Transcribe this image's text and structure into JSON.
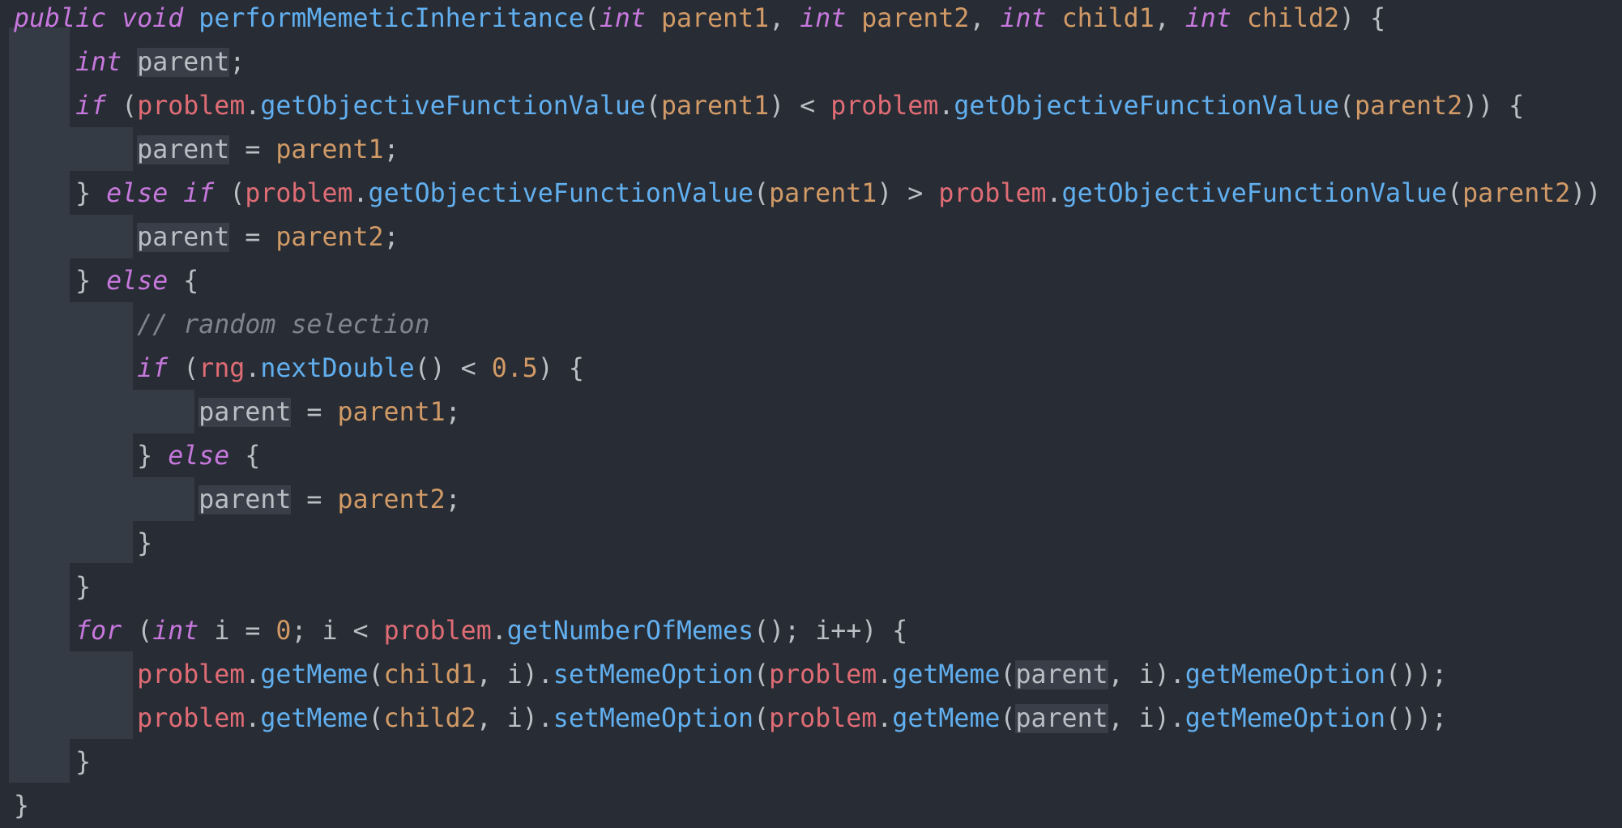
{
  "editor": {
    "language": "java",
    "colors": {
      "background": "#282c34",
      "keyword": "#c678dd",
      "method": "#61afef",
      "parameter": "#d19a66",
      "field": "#e06c75",
      "comment": "#7f848e",
      "text": "#bbbec4"
    },
    "lines": [
      {
        "tokens": [
          {
            "t": "public",
            "c": "kw"
          },
          {
            "t": " ",
            "c": "pl"
          },
          {
            "t": "void",
            "c": "kw"
          },
          {
            "t": " ",
            "c": "pl"
          },
          {
            "t": "performMemeticInheritance",
            "c": "fn"
          },
          {
            "t": "(",
            "c": "pl"
          },
          {
            "t": "int",
            "c": "kw"
          },
          {
            "t": " ",
            "c": "pl"
          },
          {
            "t": "parent1",
            "c": "param"
          },
          {
            "t": ", ",
            "c": "pl"
          },
          {
            "t": "int",
            "c": "kw"
          },
          {
            "t": " ",
            "c": "pl"
          },
          {
            "t": "parent2",
            "c": "param"
          },
          {
            "t": ", ",
            "c": "pl"
          },
          {
            "t": "int",
            "c": "kw"
          },
          {
            "t": " ",
            "c": "pl"
          },
          {
            "t": "child1",
            "c": "param"
          },
          {
            "t": ", ",
            "c": "pl"
          },
          {
            "t": "int",
            "c": "kw"
          },
          {
            "t": " ",
            "c": "pl"
          },
          {
            "t": "child2",
            "c": "param"
          },
          {
            "t": ") {",
            "c": "pl"
          }
        ]
      },
      {
        "tokens": [
          {
            "t": "    ",
            "c": "pl"
          },
          {
            "t": "int",
            "c": "kw"
          },
          {
            "t": " ",
            "c": "pl"
          },
          {
            "t": "parent",
            "c": "pl hl"
          },
          {
            "t": ";",
            "c": "pl"
          }
        ]
      },
      {
        "tokens": [
          {
            "t": "    ",
            "c": "pl"
          },
          {
            "t": "if",
            "c": "kw"
          },
          {
            "t": " (",
            "c": "pl"
          },
          {
            "t": "problem",
            "c": "obj"
          },
          {
            "t": ".",
            "c": "pl"
          },
          {
            "t": "getObjectiveFunctionValue",
            "c": "fn"
          },
          {
            "t": "(",
            "c": "pl"
          },
          {
            "t": "parent1",
            "c": "param"
          },
          {
            "t": ") < ",
            "c": "pl"
          },
          {
            "t": "problem",
            "c": "obj"
          },
          {
            "t": ".",
            "c": "pl"
          },
          {
            "t": "getObjectiveFunctionValue",
            "c": "fn"
          },
          {
            "t": "(",
            "c": "pl"
          },
          {
            "t": "parent2",
            "c": "param"
          },
          {
            "t": ")) {",
            "c": "pl"
          }
        ]
      },
      {
        "tokens": [
          {
            "t": "        ",
            "c": "pl"
          },
          {
            "t": "parent",
            "c": "pl hl"
          },
          {
            "t": " = ",
            "c": "pl"
          },
          {
            "t": "parent1",
            "c": "param"
          },
          {
            "t": ";",
            "c": "pl"
          }
        ]
      },
      {
        "tokens": [
          {
            "t": "    } ",
            "c": "pl"
          },
          {
            "t": "else",
            "c": "kw"
          },
          {
            "t": " ",
            "c": "pl"
          },
          {
            "t": "if",
            "c": "kw"
          },
          {
            "t": " (",
            "c": "pl"
          },
          {
            "t": "problem",
            "c": "obj"
          },
          {
            "t": ".",
            "c": "pl"
          },
          {
            "t": "getObjectiveFunctionValue",
            "c": "fn"
          },
          {
            "t": "(",
            "c": "pl"
          },
          {
            "t": "parent1",
            "c": "param"
          },
          {
            "t": ") > ",
            "c": "pl"
          },
          {
            "t": "problem",
            "c": "obj"
          },
          {
            "t": ".",
            "c": "pl"
          },
          {
            "t": "getObjectiveFunctionValue",
            "c": "fn"
          },
          {
            "t": "(",
            "c": "pl"
          },
          {
            "t": "parent2",
            "c": "param"
          },
          {
            "t": "))",
            "c": "pl"
          }
        ]
      },
      {
        "tokens": [
          {
            "t": "        ",
            "c": "pl"
          },
          {
            "t": "parent",
            "c": "pl hl"
          },
          {
            "t": " = ",
            "c": "pl"
          },
          {
            "t": "parent2",
            "c": "param"
          },
          {
            "t": ";",
            "c": "pl"
          }
        ]
      },
      {
        "tokens": [
          {
            "t": "    } ",
            "c": "pl"
          },
          {
            "t": "else",
            "c": "kw"
          },
          {
            "t": " {",
            "c": "pl"
          }
        ]
      },
      {
        "tokens": [
          {
            "t": "        ",
            "c": "pl"
          },
          {
            "t": "// random selection",
            "c": "cm"
          }
        ]
      },
      {
        "tokens": [
          {
            "t": "        ",
            "c": "pl"
          },
          {
            "t": "if",
            "c": "kw"
          },
          {
            "t": " (",
            "c": "pl"
          },
          {
            "t": "rng",
            "c": "obj"
          },
          {
            "t": ".",
            "c": "pl"
          },
          {
            "t": "nextDouble",
            "c": "fn"
          },
          {
            "t": "() < ",
            "c": "pl"
          },
          {
            "t": "0.5",
            "c": "num"
          },
          {
            "t": ") {",
            "c": "pl"
          }
        ]
      },
      {
        "tokens": [
          {
            "t": "            ",
            "c": "pl"
          },
          {
            "t": "parent",
            "c": "pl hl"
          },
          {
            "t": " = ",
            "c": "pl"
          },
          {
            "t": "parent1",
            "c": "param"
          },
          {
            "t": ";",
            "c": "pl"
          }
        ]
      },
      {
        "tokens": [
          {
            "t": "        } ",
            "c": "pl"
          },
          {
            "t": "else",
            "c": "kw"
          },
          {
            "t": " {",
            "c": "pl"
          }
        ]
      },
      {
        "tokens": [
          {
            "t": "            ",
            "c": "pl"
          },
          {
            "t": "parent",
            "c": "pl hl"
          },
          {
            "t": " = ",
            "c": "pl"
          },
          {
            "t": "parent2",
            "c": "param"
          },
          {
            "t": ";",
            "c": "pl"
          }
        ]
      },
      {
        "tokens": [
          {
            "t": "        }",
            "c": "pl"
          }
        ]
      },
      {
        "tokens": [
          {
            "t": "    }",
            "c": "pl"
          }
        ]
      },
      {
        "tokens": [
          {
            "t": "    ",
            "c": "pl"
          },
          {
            "t": "for",
            "c": "kw"
          },
          {
            "t": " (",
            "c": "pl"
          },
          {
            "t": "int",
            "c": "kw"
          },
          {
            "t": " i = ",
            "c": "pl"
          },
          {
            "t": "0",
            "c": "num"
          },
          {
            "t": "; i < ",
            "c": "pl"
          },
          {
            "t": "problem",
            "c": "obj"
          },
          {
            "t": ".",
            "c": "pl"
          },
          {
            "t": "getNumberOfMemes",
            "c": "fn"
          },
          {
            "t": "(); i++) {",
            "c": "pl"
          }
        ]
      },
      {
        "tokens": [
          {
            "t": "        ",
            "c": "pl"
          },
          {
            "t": "problem",
            "c": "obj"
          },
          {
            "t": ".",
            "c": "pl"
          },
          {
            "t": "getMeme",
            "c": "fn"
          },
          {
            "t": "(",
            "c": "pl"
          },
          {
            "t": "child1",
            "c": "param"
          },
          {
            "t": ", i).",
            "c": "pl"
          },
          {
            "t": "setMemeOption",
            "c": "fn"
          },
          {
            "t": "(",
            "c": "pl"
          },
          {
            "t": "problem",
            "c": "obj"
          },
          {
            "t": ".",
            "c": "pl"
          },
          {
            "t": "getMeme",
            "c": "fn"
          },
          {
            "t": "(",
            "c": "pl"
          },
          {
            "t": "parent",
            "c": "pl hl"
          },
          {
            "t": ", i).",
            "c": "pl"
          },
          {
            "t": "getMemeOption",
            "c": "fn"
          },
          {
            "t": "());",
            "c": "pl"
          }
        ]
      },
      {
        "tokens": [
          {
            "t": "        ",
            "c": "pl"
          },
          {
            "t": "problem",
            "c": "obj"
          },
          {
            "t": ".",
            "c": "pl"
          },
          {
            "t": "getMeme",
            "c": "fn"
          },
          {
            "t": "(",
            "c": "pl"
          },
          {
            "t": "child2",
            "c": "param"
          },
          {
            "t": ", i).",
            "c": "pl"
          },
          {
            "t": "setMemeOption",
            "c": "fn"
          },
          {
            "t": "(",
            "c": "pl"
          },
          {
            "t": "problem",
            "c": "obj"
          },
          {
            "t": ".",
            "c": "pl"
          },
          {
            "t": "getMeme",
            "c": "fn"
          },
          {
            "t": "(",
            "c": "pl"
          },
          {
            "t": "parent",
            "c": "pl hl"
          },
          {
            "t": ", i).",
            "c": "pl"
          },
          {
            "t": "getMemeOption",
            "c": "fn"
          },
          {
            "t": "());",
            "c": "pl"
          }
        ]
      },
      {
        "tokens": [
          {
            "t": "    }",
            "c": "pl"
          }
        ]
      },
      {
        "tokens": [
          {
            "t": "}",
            "c": "pl"
          }
        ]
      }
    ]
  }
}
